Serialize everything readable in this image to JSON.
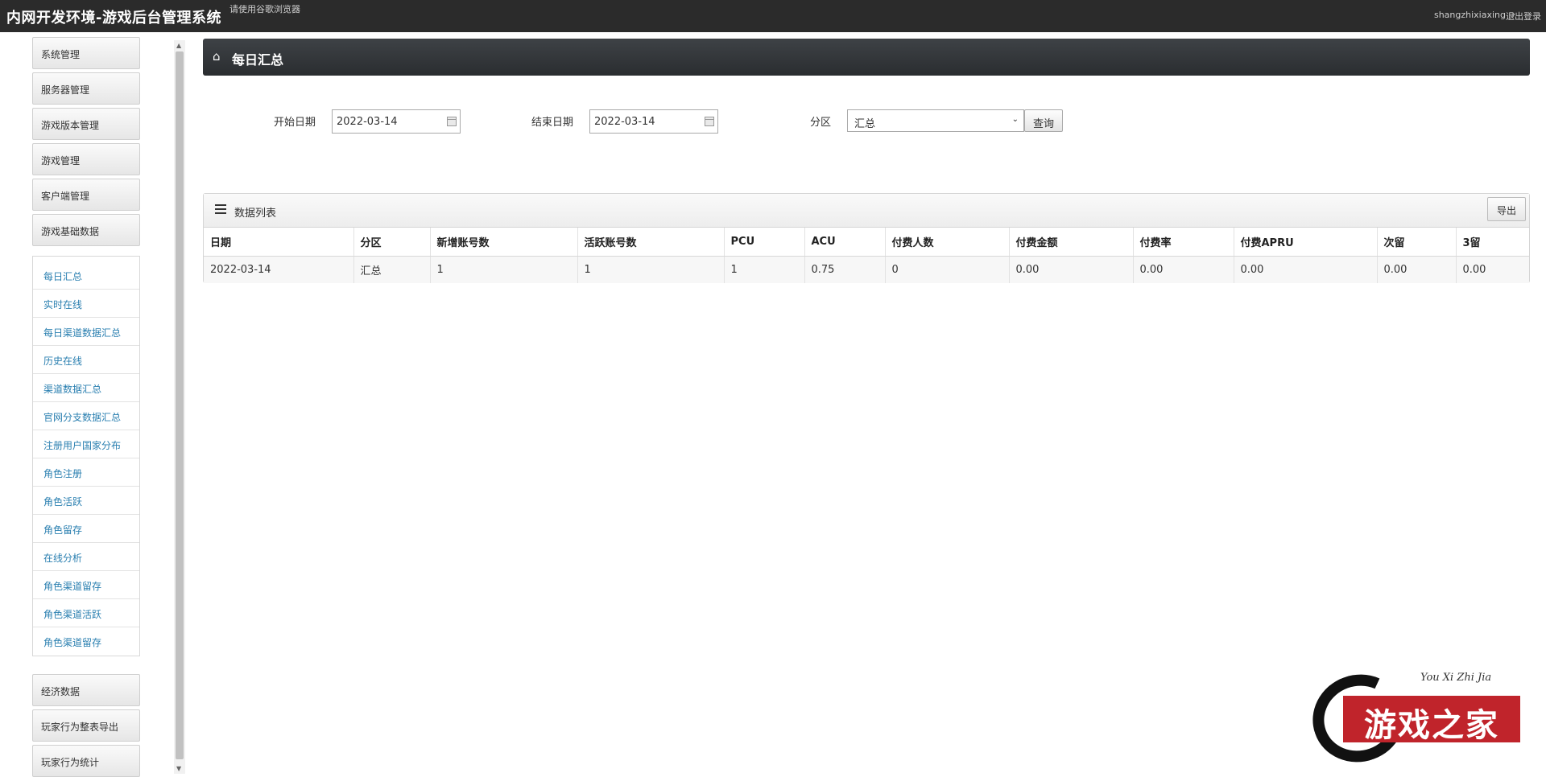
{
  "topbar": {
    "title": "内网开发环境-游戏后台管理系统",
    "hint": "请使用谷歌浏览器",
    "user": "shangzhixiaxing",
    "logout": "退出登录"
  },
  "sidebar": {
    "top_menu": [
      {
        "label": "系统管理"
      },
      {
        "label": "服务器管理"
      },
      {
        "label": "游戏版本管理"
      },
      {
        "label": "游戏管理"
      },
      {
        "label": "客户端管理"
      },
      {
        "label": "游戏基础数据"
      }
    ],
    "sub_menu": [
      {
        "label": "每日汇总"
      },
      {
        "label": "实时在线"
      },
      {
        "label": "每日渠道数据汇总"
      },
      {
        "label": "历史在线"
      },
      {
        "label": "渠道数据汇总"
      },
      {
        "label": "官网分支数据汇总"
      },
      {
        "label": "注册用户国家分布"
      },
      {
        "label": "角色注册"
      },
      {
        "label": "角色活跃"
      },
      {
        "label": "角色留存"
      },
      {
        "label": "在线分析"
      },
      {
        "label": "角色渠道留存"
      },
      {
        "label": "角色渠道活跃"
      },
      {
        "label": "角色渠道留存"
      }
    ],
    "bottom_menu": [
      {
        "label": "经济数据"
      },
      {
        "label": "玩家行为整表导出"
      },
      {
        "label": "玩家行为统计"
      }
    ]
  },
  "page": {
    "title": "每日汇总"
  },
  "filters": {
    "start_label": "开始日期",
    "start_value": "2022-03-14",
    "end_label": "结束日期",
    "end_value": "2022-03-14",
    "zone_label": "分区",
    "zone_value": "汇总",
    "query_label": "查询"
  },
  "panel": {
    "title": "数据列表",
    "export_label": "导出",
    "columns": [
      "日期",
      "分区",
      "新增账号数",
      "活跃账号数",
      "PCU",
      "ACU",
      "付费人数",
      "付费金额",
      "付费率",
      "付费APRU",
      "次留",
      "3留"
    ],
    "rows": [
      [
        "2022-03-14",
        "汇总",
        "1",
        "1",
        "1",
        "0.75",
        "0",
        "0.00",
        "0.00",
        "0.00",
        "0.00",
        "0.00"
      ]
    ]
  },
  "logo": {
    "script": "You Xi Zhi Jia",
    "brand": "游戏之家"
  },
  "colors": {
    "topbar": "#2b2b2b",
    "page_header": "#34373a",
    "link": "#2a7fb0",
    "brand_red": "#c0242b"
  }
}
